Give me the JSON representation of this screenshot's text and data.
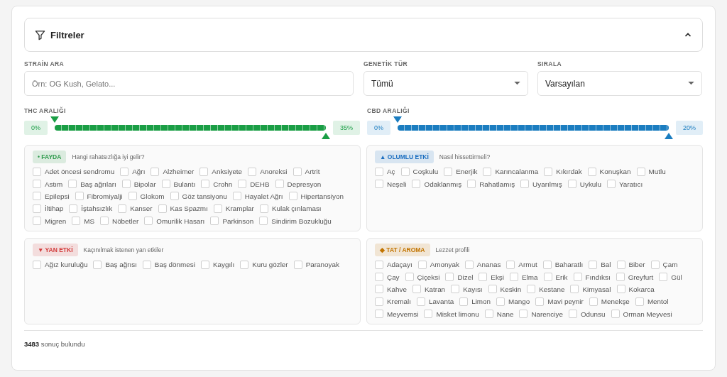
{
  "header": {
    "title": "Filtreler",
    "expanded": true
  },
  "search": {
    "label": "STRAİN ARA",
    "placeholder": "Örn: OG Kush, Gelato..."
  },
  "selects": [
    {
      "label": "GENETİK TÜR",
      "value": "Tümü"
    },
    {
      "label": "SIRALA",
      "value": "Varsayılan"
    }
  ],
  "ranges": [
    {
      "label": "THC ARALIĞI",
      "min_text": "0%",
      "max_text": "35%",
      "color": "#1a9e45",
      "thumbs": [
        {
          "level": 0
        },
        {
          "level": 1
        }
      ]
    },
    {
      "label": "CBD ARALIĞI",
      "min_text": "0%",
      "max_text": "20%",
      "color": "#1b7dc0",
      "thumbs": [
        {
          "level": 0
        },
        {
          "level": 1
        }
      ]
    }
  ],
  "groups": [
    {
      "badge": "• FAYDA",
      "hint": "Hangi rahatsızlığa iyi gelir?",
      "color": "#2e9a4c",
      "options": [
        {
          "label": "Adet öncesi sendromu",
          "checked": false
        },
        {
          "label": "Ağrı",
          "checked": false
        },
        {
          "label": "Alzheimer",
          "checked": false
        },
        {
          "label": "Anksiyete",
          "checked": false
        },
        {
          "label": "Anoreksi",
          "checked": false
        },
        {
          "label": "Artrit",
          "checked": false
        },
        {
          "label": "Astım",
          "checked": false
        },
        {
          "label": "Baş ağrıları",
          "checked": false
        },
        {
          "label": "Bipolar",
          "checked": false
        },
        {
          "label": "Bulantı",
          "checked": false
        },
        {
          "label": "Crohn",
          "checked": false
        },
        {
          "label": "DEHB",
          "checked": false
        },
        {
          "label": "Depresyon",
          "checked": false
        },
        {
          "label": "Epilepsi",
          "checked": false
        },
        {
          "label": "Fibromiyalji",
          "checked": false
        },
        {
          "label": "Glokom",
          "checked": false
        },
        {
          "label": "Göz tansiyonu",
          "checked": false
        },
        {
          "label": "Hayalet Ağrı",
          "checked": false
        },
        {
          "label": "Hipertansiyon",
          "checked": false
        },
        {
          "label": "İltihap",
          "checked": false
        },
        {
          "label": "İştahsızlık",
          "checked": false
        },
        {
          "label": "Kanser",
          "checked": false
        },
        {
          "label": "Kas Spazmı",
          "checked": false
        },
        {
          "label": "Kramplar",
          "checked": false
        },
        {
          "label": "Kulak çınlaması",
          "checked": false
        },
        {
          "label": "Migren",
          "checked": false
        },
        {
          "label": "MS",
          "checked": false
        },
        {
          "label": "Nöbetler",
          "checked": false
        },
        {
          "label": "Omurilik Hasarı",
          "checked": false
        },
        {
          "label": "Parkinson",
          "checked": false
        },
        {
          "label": "Sindirim Bozukluğu",
          "checked": false
        }
      ]
    },
    {
      "badge": "▲ OLUMLU ETKİ",
      "hint": "Nasıl hissettirmeli?",
      "color": "#1d6fc0",
      "options": [
        {
          "label": "Aç",
          "checked": false
        },
        {
          "label": "Coşkulu",
          "checked": false
        },
        {
          "label": "Enerjik",
          "checked": false
        },
        {
          "label": "Karıncalanma",
          "checked": false
        },
        {
          "label": "Kıkırdak",
          "checked": false
        },
        {
          "label": "Konuşkan",
          "checked": false
        },
        {
          "label": "Mutlu",
          "checked": false
        },
        {
          "label": "Neşeli",
          "checked": false
        },
        {
          "label": "Odaklanmış",
          "checked": false
        },
        {
          "label": "Rahatlamış",
          "checked": false
        },
        {
          "label": "Uyarılmış",
          "checked": false
        },
        {
          "label": "Uykulu",
          "checked": false
        },
        {
          "label": "Yaratıcı",
          "checked": false
        }
      ]
    },
    {
      "badge": "▼ YAN ETKİ",
      "hint": "Kaçınılmak istenen yan etkiler",
      "color": "#d23a3a",
      "options": [
        {
          "label": "Ağız kuruluğu",
          "checked": false
        },
        {
          "label": "Baş ağrısı",
          "checked": false
        },
        {
          "label": "Baş dönmesi",
          "checked": false
        },
        {
          "label": "Kaygılı",
          "checked": false
        },
        {
          "label": "Kuru gözler",
          "checked": false
        },
        {
          "label": "Paranoyak",
          "checked": false
        }
      ]
    },
    {
      "badge": "◆ TAT / AROMA",
      "hint": "Lezzet profili",
      "color": "#c27400",
      "options": [
        {
          "label": "Adaçayı",
          "checked": false
        },
        {
          "label": "Amonyak",
          "checked": false
        },
        {
          "label": "Ananas",
          "checked": false
        },
        {
          "label": "Armut",
          "checked": false
        },
        {
          "label": "Baharatlı",
          "checked": false
        },
        {
          "label": "Bal",
          "checked": false
        },
        {
          "label": "Biber",
          "checked": false
        },
        {
          "label": "Çam",
          "checked": false
        },
        {
          "label": "Çay",
          "checked": false
        },
        {
          "label": "Çiçeksi",
          "checked": false
        },
        {
          "label": "Dizel",
          "checked": false
        },
        {
          "label": "Ekşi",
          "checked": false
        },
        {
          "label": "Elma",
          "checked": false
        },
        {
          "label": "Erik",
          "checked": false
        },
        {
          "label": "Fındıksı",
          "checked": false
        },
        {
          "label": "Greyfurt",
          "checked": false
        },
        {
          "label": "Gül",
          "checked": false
        },
        {
          "label": "Kahve",
          "checked": false
        },
        {
          "label": "Katran",
          "checked": false
        },
        {
          "label": "Kayısı",
          "checked": false
        },
        {
          "label": "Keskin",
          "checked": false
        },
        {
          "label": "Kestane",
          "checked": false
        },
        {
          "label": "Kimyasal",
          "checked": false
        },
        {
          "label": "Kokarca",
          "checked": false
        },
        {
          "label": "Kremalı",
          "checked": false
        },
        {
          "label": "Lavanta",
          "checked": false
        },
        {
          "label": "Limon",
          "checked": false
        },
        {
          "label": "Mango",
          "checked": false
        },
        {
          "label": "Mavi peynir",
          "checked": false
        },
        {
          "label": "Menekşe",
          "checked": false
        },
        {
          "label": "Mentol",
          "checked": false
        },
        {
          "label": "Meyvemsi",
          "checked": false
        },
        {
          "label": "Misket limonu",
          "checked": false
        },
        {
          "label": "Nane",
          "checked": false
        },
        {
          "label": "Narenciye",
          "checked": false
        },
        {
          "label": "Odunsu",
          "checked": false
        },
        {
          "label": "Orman Meyvesi",
          "checked": false
        }
      ]
    }
  ],
  "results": "**3483** sonuç bulundu"
}
